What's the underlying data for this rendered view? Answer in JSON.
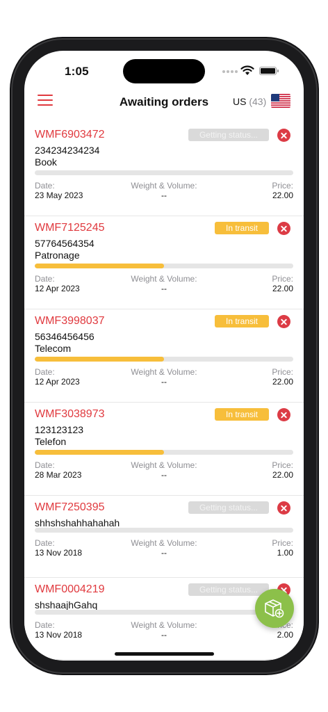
{
  "status_bar": {
    "time": "1:05"
  },
  "header": {
    "title": "Awaiting orders",
    "region_code": "US",
    "region_count": "(43)",
    "flag_icon": "us-flag-icon"
  },
  "colors": {
    "accent": "#e0393e",
    "in_transit": "#f7be3b",
    "pending_badge": "#dadada",
    "fab": "#8cc04a"
  },
  "labels": {
    "date": "Date:",
    "weight_volume": "Weight & Volume:",
    "price": "Price:"
  },
  "orders": [
    {
      "id": "WMF6903472",
      "status": "Getting status...",
      "tracking": "234234234234",
      "description": "Book",
      "progress": 0,
      "date": "23 May 2023",
      "weight_volume": "--",
      "price": "22.00"
    },
    {
      "id": "WMF7125245",
      "status": "In transit",
      "tracking": "57764564354",
      "description": "Patronage",
      "progress": 0.5,
      "date": "12 Apr 2023",
      "weight_volume": "--",
      "price": "22.00"
    },
    {
      "id": "WMF3998037",
      "status": "In transit",
      "tracking": "56346456456",
      "description": "Telecom",
      "progress": 0.5,
      "date": "12 Apr 2023",
      "weight_volume": "--",
      "price": "22.00"
    },
    {
      "id": "WMF3038973",
      "status": "In transit",
      "tracking": "123123123",
      "description": "Telefon",
      "progress": 0.5,
      "date": "28 Mar 2023",
      "weight_volume": "--",
      "price": "22.00"
    },
    {
      "id": "WMF7250395",
      "status": "Getting status...",
      "tracking": "shhshshahhahahah",
      "description": "",
      "progress": 0,
      "date": "13 Nov 2018",
      "weight_volume": "--",
      "price": "1.00"
    },
    {
      "id": "WMF0004219",
      "status": "Getting status...",
      "tracking": "shshaajhGahq",
      "description": "",
      "progress": 0,
      "date": "13 Nov 2018",
      "weight_volume": "--",
      "price": "2.00"
    }
  ],
  "fab": {
    "icon": "add-package-icon"
  }
}
